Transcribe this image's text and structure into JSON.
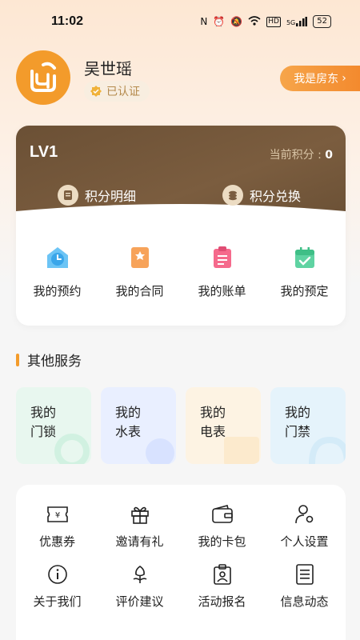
{
  "status_bar": {
    "time": "11:02",
    "battery": "52",
    "hd": "HD",
    "net": "5G"
  },
  "profile": {
    "name": "吴世瑶",
    "verified_label": "已认证",
    "landlord_button": "我是房东"
  },
  "points_card": {
    "level": "LV1",
    "current_points_label": "当前积分 : ",
    "current_points_value": "0",
    "points_detail": "积分明细",
    "points_exchange": "积分兑换"
  },
  "quick_actions": [
    {
      "label": "我的预约",
      "icon": "clock-icon"
    },
    {
      "label": "我的合同",
      "icon": "bookmark-icon"
    },
    {
      "label": "我的账单",
      "icon": "clipboard-icon"
    },
    {
      "label": "我的预定",
      "icon": "calendar-check-icon"
    }
  ],
  "other_services": {
    "title": "其他服务",
    "tiles": [
      {
        "line1": "我的",
        "line2": "门锁",
        "color": "#e8f7ef"
      },
      {
        "line1": "我的",
        "line2": "水表",
        "color": "#e9efff"
      },
      {
        "line1": "我的",
        "line2": "电表",
        "color": "#fdf3e3"
      },
      {
        "line1": "我的",
        "line2": "门禁",
        "color": "#e5f3fb"
      }
    ]
  },
  "grid_menu": [
    {
      "label": "优惠券",
      "icon": "coupon-icon"
    },
    {
      "label": "邀请有礼",
      "icon": "gift-icon"
    },
    {
      "label": "我的卡包",
      "icon": "wallet-icon"
    },
    {
      "label": "个人设置",
      "icon": "user-settings-icon"
    },
    {
      "label": "关于我们",
      "icon": "info-icon"
    },
    {
      "label": "评价建议",
      "icon": "flower-icon"
    },
    {
      "label": "活动报名",
      "icon": "badge-icon"
    },
    {
      "label": "信息动态",
      "icon": "document-icon"
    }
  ],
  "colors": {
    "accent": "#f39b2b",
    "points_bg": "#6e5337"
  }
}
